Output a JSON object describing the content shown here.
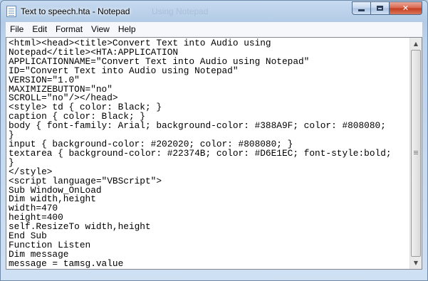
{
  "window": {
    "title": "Text to speech.hta - Notepad",
    "background_title_ghost": "Using Notepad"
  },
  "menu": [
    {
      "label": "File"
    },
    {
      "label": "Edit"
    },
    {
      "label": "Format"
    },
    {
      "label": "View"
    },
    {
      "label": "Help"
    }
  ],
  "editor": {
    "content": "<html><head><title>Convert Text into Audio using\nNotepad</title><HTA:APPLICATION\nAPPLICATIONNAME=\"Convert Text into Audio using Notepad\"\nID=\"Convert Text into Audio using Notepad\"\nVERSION=\"1.0\"\nMAXIMIZEBUTTON=\"no\"\nSCROLL=\"no\"/></head>\n<style> td { color: Black; }\ncaption { color: Black; }\nbody { font-family: Arial; background-color: #388A9F; color: #808080;\n}\ninput { background-color: #202020; color: #808080; }\ntextarea { background-color: #22374B; color: #D6E1EC; font-style:bold;\n}\n</style>\n<script language=\"VBScript\">\nSub Window_OnLoad\nDim width,height\nwidth=470\nheight=400\nself.ResizeTo width,height\nEnd Sub\nFunction Listen\nDim message\nmessage = tamsg.value"
  },
  "colors": {
    "titlebar": "#b3cbe6",
    "close_button": "#c43c1f",
    "editor_bg": "#ffffff"
  }
}
